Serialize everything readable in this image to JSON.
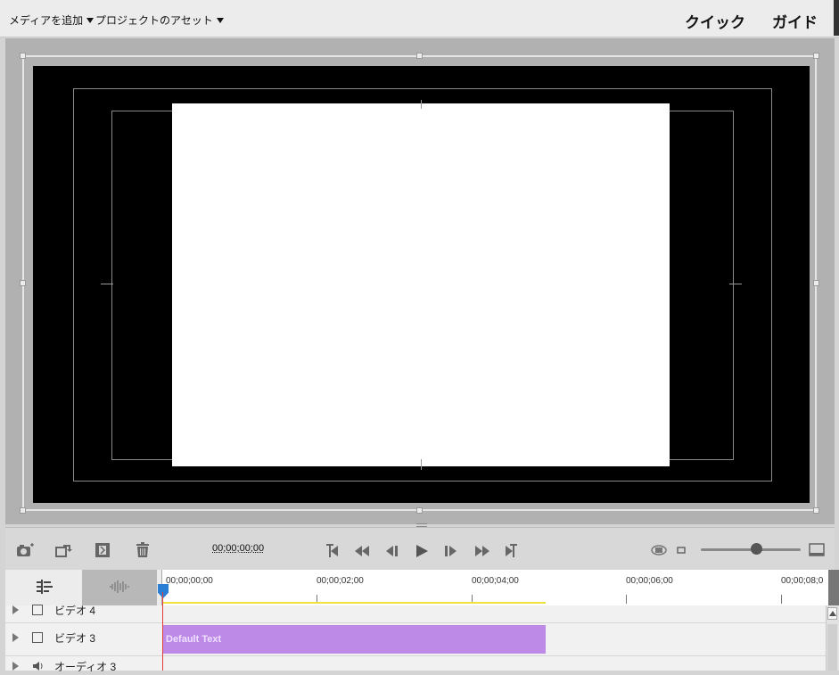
{
  "menus": {
    "add_media": "メディアを追加",
    "project_assets": "プロジェクトのアセット"
  },
  "modes": {
    "quick": "クイック",
    "guided": "ガイド"
  },
  "controls": {
    "timecode": "00;00;00;00"
  },
  "ruler": {
    "labels": [
      "00;00;00;00",
      "00;00;02;00",
      "00;00;04;00",
      "00;00;06;00",
      "00;00;08;0"
    ]
  },
  "tracks": [
    {
      "name": "ビデオ 4",
      "icon": "film-icon"
    },
    {
      "name": "ビデオ 3",
      "icon": "film-icon"
    },
    {
      "name": "オーディオ 3",
      "icon": "speaker-icon"
    }
  ],
  "clip": {
    "label": "Default Text",
    "color": "#bd8ae8"
  },
  "colors": {
    "playhead": "#e53c3c",
    "work_area": "#f0e040",
    "playhead_flag": "#2a7fd4"
  },
  "zoom": {
    "level": 0.55
  }
}
